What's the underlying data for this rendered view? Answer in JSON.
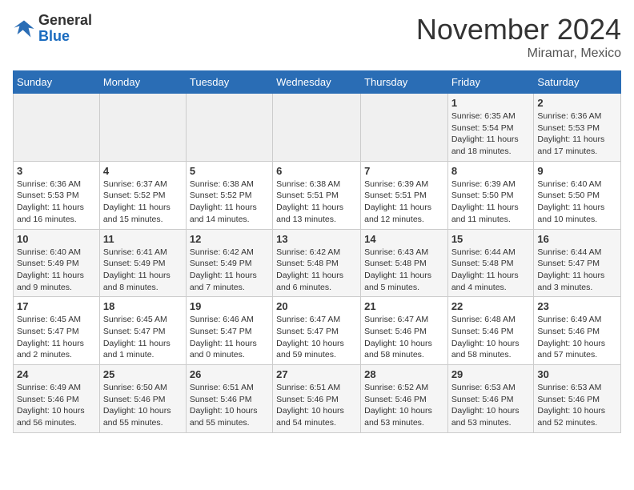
{
  "logo": {
    "general": "General",
    "blue": "Blue"
  },
  "title": "November 2024",
  "location": "Miramar, Mexico",
  "days_header": [
    "Sunday",
    "Monday",
    "Tuesday",
    "Wednesday",
    "Thursday",
    "Friday",
    "Saturday"
  ],
  "weeks": [
    [
      {
        "num": "",
        "info": ""
      },
      {
        "num": "",
        "info": ""
      },
      {
        "num": "",
        "info": ""
      },
      {
        "num": "",
        "info": ""
      },
      {
        "num": "",
        "info": ""
      },
      {
        "num": "1",
        "info": "Sunrise: 6:35 AM\nSunset: 5:54 PM\nDaylight: 11 hours and 18 minutes."
      },
      {
        "num": "2",
        "info": "Sunrise: 6:36 AM\nSunset: 5:53 PM\nDaylight: 11 hours and 17 minutes."
      }
    ],
    [
      {
        "num": "3",
        "info": "Sunrise: 6:36 AM\nSunset: 5:53 PM\nDaylight: 11 hours and 16 minutes."
      },
      {
        "num": "4",
        "info": "Sunrise: 6:37 AM\nSunset: 5:52 PM\nDaylight: 11 hours and 15 minutes."
      },
      {
        "num": "5",
        "info": "Sunrise: 6:38 AM\nSunset: 5:52 PM\nDaylight: 11 hours and 14 minutes."
      },
      {
        "num": "6",
        "info": "Sunrise: 6:38 AM\nSunset: 5:51 PM\nDaylight: 11 hours and 13 minutes."
      },
      {
        "num": "7",
        "info": "Sunrise: 6:39 AM\nSunset: 5:51 PM\nDaylight: 11 hours and 12 minutes."
      },
      {
        "num": "8",
        "info": "Sunrise: 6:39 AM\nSunset: 5:50 PM\nDaylight: 11 hours and 11 minutes."
      },
      {
        "num": "9",
        "info": "Sunrise: 6:40 AM\nSunset: 5:50 PM\nDaylight: 11 hours and 10 minutes."
      }
    ],
    [
      {
        "num": "10",
        "info": "Sunrise: 6:40 AM\nSunset: 5:49 PM\nDaylight: 11 hours and 9 minutes."
      },
      {
        "num": "11",
        "info": "Sunrise: 6:41 AM\nSunset: 5:49 PM\nDaylight: 11 hours and 8 minutes."
      },
      {
        "num": "12",
        "info": "Sunrise: 6:42 AM\nSunset: 5:49 PM\nDaylight: 11 hours and 7 minutes."
      },
      {
        "num": "13",
        "info": "Sunrise: 6:42 AM\nSunset: 5:48 PM\nDaylight: 11 hours and 6 minutes."
      },
      {
        "num": "14",
        "info": "Sunrise: 6:43 AM\nSunset: 5:48 PM\nDaylight: 11 hours and 5 minutes."
      },
      {
        "num": "15",
        "info": "Sunrise: 6:44 AM\nSunset: 5:48 PM\nDaylight: 11 hours and 4 minutes."
      },
      {
        "num": "16",
        "info": "Sunrise: 6:44 AM\nSunset: 5:47 PM\nDaylight: 11 hours and 3 minutes."
      }
    ],
    [
      {
        "num": "17",
        "info": "Sunrise: 6:45 AM\nSunset: 5:47 PM\nDaylight: 11 hours and 2 minutes."
      },
      {
        "num": "18",
        "info": "Sunrise: 6:45 AM\nSunset: 5:47 PM\nDaylight: 11 hours and 1 minute."
      },
      {
        "num": "19",
        "info": "Sunrise: 6:46 AM\nSunset: 5:47 PM\nDaylight: 11 hours and 0 minutes."
      },
      {
        "num": "20",
        "info": "Sunrise: 6:47 AM\nSunset: 5:47 PM\nDaylight: 10 hours and 59 minutes."
      },
      {
        "num": "21",
        "info": "Sunrise: 6:47 AM\nSunset: 5:46 PM\nDaylight: 10 hours and 58 minutes."
      },
      {
        "num": "22",
        "info": "Sunrise: 6:48 AM\nSunset: 5:46 PM\nDaylight: 10 hours and 58 minutes."
      },
      {
        "num": "23",
        "info": "Sunrise: 6:49 AM\nSunset: 5:46 PM\nDaylight: 10 hours and 57 minutes."
      }
    ],
    [
      {
        "num": "24",
        "info": "Sunrise: 6:49 AM\nSunset: 5:46 PM\nDaylight: 10 hours and 56 minutes."
      },
      {
        "num": "25",
        "info": "Sunrise: 6:50 AM\nSunset: 5:46 PM\nDaylight: 10 hours and 55 minutes."
      },
      {
        "num": "26",
        "info": "Sunrise: 6:51 AM\nSunset: 5:46 PM\nDaylight: 10 hours and 55 minutes."
      },
      {
        "num": "27",
        "info": "Sunrise: 6:51 AM\nSunset: 5:46 PM\nDaylight: 10 hours and 54 minutes."
      },
      {
        "num": "28",
        "info": "Sunrise: 6:52 AM\nSunset: 5:46 PM\nDaylight: 10 hours and 53 minutes."
      },
      {
        "num": "29",
        "info": "Sunrise: 6:53 AM\nSunset: 5:46 PM\nDaylight: 10 hours and 53 minutes."
      },
      {
        "num": "30",
        "info": "Sunrise: 6:53 AM\nSunset: 5:46 PM\nDaylight: 10 hours and 52 minutes."
      }
    ]
  ]
}
